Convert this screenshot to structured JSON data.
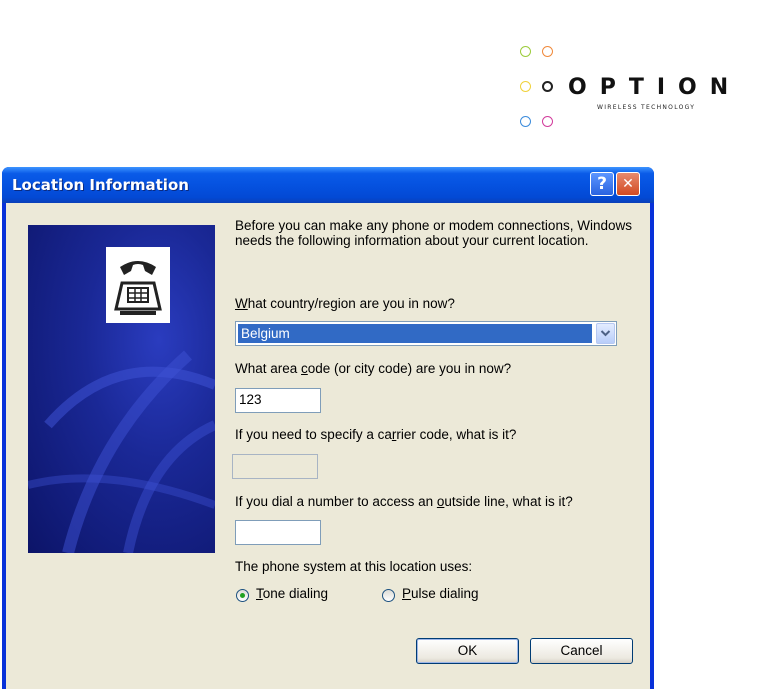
{
  "logo": {
    "word": "OPTION",
    "tagline": "WIRELESS TECHNOLOGY"
  },
  "window": {
    "title": "Location Information",
    "help_label": "?",
    "close_label": "✕"
  },
  "form": {
    "intro": "Before you can make any phone or modem connections, Windows needs the following information about your current location.",
    "country": {
      "label_mnemonic": "W",
      "label_rest": "hat country/region are you in now?",
      "value": "Belgium"
    },
    "area_code": {
      "label_before": "What area ",
      "label_mnemonic": "c",
      "label_after": "ode (or city code) are you in now?",
      "value": "123"
    },
    "carrier_code": {
      "label_before": "If you need to specify a ca",
      "label_mnemonic": "r",
      "label_after": "rier code, what is it?",
      "value": ""
    },
    "outside_line": {
      "label_before": "If you dial a number to access an ",
      "label_mnemonic": "o",
      "label_after": "utside line, what is it?",
      "value": ""
    },
    "phone_system": {
      "label": "The phone system at this location uses:",
      "tone": {
        "mnemonic": "T",
        "rest": "one dialing",
        "selected": true
      },
      "pulse": {
        "mnemonic": "P",
        "rest": "ulse dialing",
        "selected": false
      }
    }
  },
  "buttons": {
    "ok": "OK",
    "cancel": "Cancel"
  },
  "colors": {
    "title_bar": "#0552e0",
    "dialog_bg": "#ece9d8",
    "selection": "#316ac5",
    "logo_circles": [
      "#9ccc3c",
      "#f08a3c",
      "#f0d23c",
      "#222222",
      "#3c8cdc",
      "#d23c9c"
    ]
  }
}
